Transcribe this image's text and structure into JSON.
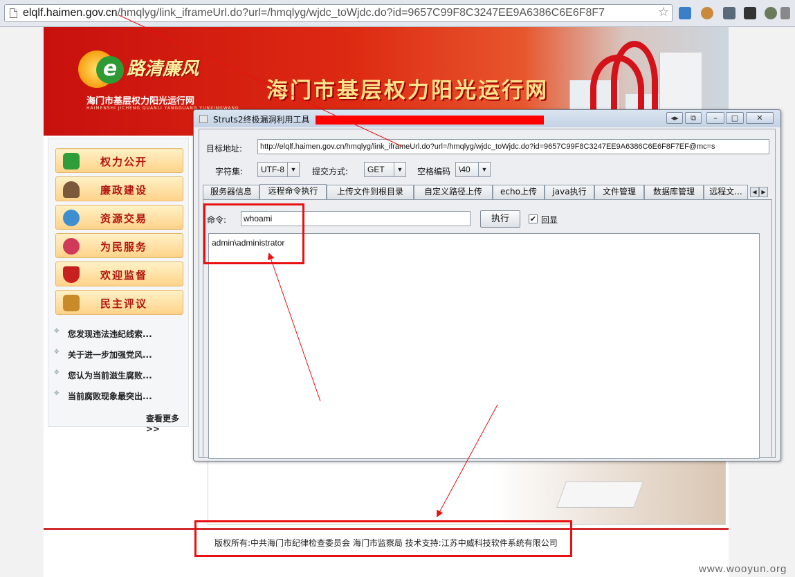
{
  "browser": {
    "url_host": "elqlf.haimen.gov.cn",
    "url_path": "/hmqlyg/link_iframeUrl.do?url=/hmqlyg/wjdc_toWjdc.do?id=9657C99F8C3247EE9A6386C6E6F8F7"
  },
  "site": {
    "logo_text": "路清廉风",
    "logo_letter": "e",
    "name": "海门市基层权力阳光运行网",
    "name_en": "HAIMENSHI JICHENG QUANLI YANGGUANG YUNXINGWANG",
    "banner_title": "海门市基层权力阳光运行网",
    "nav": [
      "权力公开",
      "廉政建设",
      "资源交易",
      "为民服务",
      "欢迎监督",
      "民主评议"
    ],
    "nav_icon_colors": [
      "#2f9e3a",
      "#7a5a3a",
      "#3f8fd0",
      "#d03a5a",
      "#c82020",
      "#c98a2a"
    ],
    "news": [
      "您发现违法违纪线索...",
      "关于进一步加强党风...",
      "您认为当前滋生腐败...",
      "当前腐败现象最突出..."
    ],
    "more": "查看更多>>",
    "footer": "版权所有:中共海门市纪律检查委员会 海门市监察局 技术支持:江苏中威科技软件系统有限公司"
  },
  "tool": {
    "title": "Struts2终极漏洞利用工具",
    "target_label": "目标地址:",
    "target_url": "http://elqlf.haimen.gov.cn/hmqlyg/link_iframeUrl.do?url=/hmqlyg/wjdc_toWjdc.do?id=9657C99F8C3247EE9A6386C6E6F8F7EF@mc=s",
    "charset_label": "字符集:",
    "charset_value": "UTF-8",
    "method_label": "提交方式:",
    "method_value": "GET",
    "space_label": "空格编码",
    "space_value": "\\40",
    "tabs": [
      "服务器信息",
      "远程命令执行",
      "上传文件到根目录",
      "自定义路径上传",
      "echo上传",
      "java执行",
      "文件管理",
      "数据库管理",
      "远程文..."
    ],
    "active_tab_index": 1,
    "command_label": "命令:",
    "command_value": "whoami",
    "exec_button": "执行",
    "echo_label": "回显",
    "echo_checked": "✔",
    "output": "admin\\administrator"
  },
  "watermark": "www.wooyun.org",
  "colors": {
    "annotation_red": "#e81010",
    "redaction_red": "#ff0000",
    "banner_red": "#c8100e"
  }
}
